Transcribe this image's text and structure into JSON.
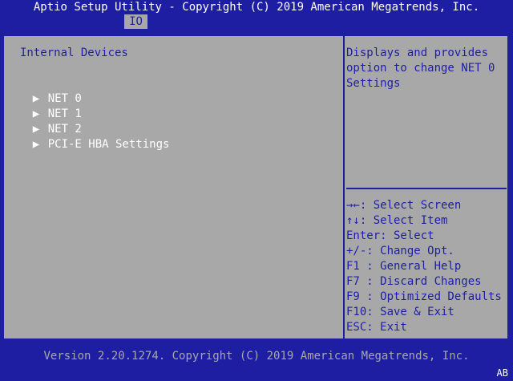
{
  "header": {
    "title": "Aptio Setup Utility - Copyright (C) 2019 American Megatrends, Inc.",
    "tabs": [
      {
        "label": "IO",
        "active": true
      }
    ]
  },
  "main": {
    "section_title": "Internal Devices",
    "menu_items": [
      {
        "label": "NET 0",
        "arrow": "▶"
      },
      {
        "label": "NET 1",
        "arrow": "▶"
      },
      {
        "label": "NET 2",
        "arrow": "▶"
      },
      {
        "label": "PCI-E HBA Settings",
        "arrow": "▶"
      }
    ]
  },
  "help": {
    "lines": [
      "Displays and provides",
      "option to change NET 0",
      "Settings"
    ]
  },
  "keys": [
    "→←: Select Screen",
    "↑↓: Select Item",
    "Enter: Select",
    "+/-: Change Opt.",
    "F1 : General Help",
    "F7 : Discard Changes",
    "F9 : Optimized Defaults",
    "F10: Save & Exit",
    "ESC: Exit"
  ],
  "footer": {
    "version": "Version 2.20.1274. Copyright (C) 2019 American Megatrends, Inc.",
    "corner": "AB"
  },
  "colors": {
    "background": "#1e1ea3",
    "panel": "#a8a8a8",
    "text_white": "#ffffff",
    "text_blue": "#1e1ea3"
  }
}
